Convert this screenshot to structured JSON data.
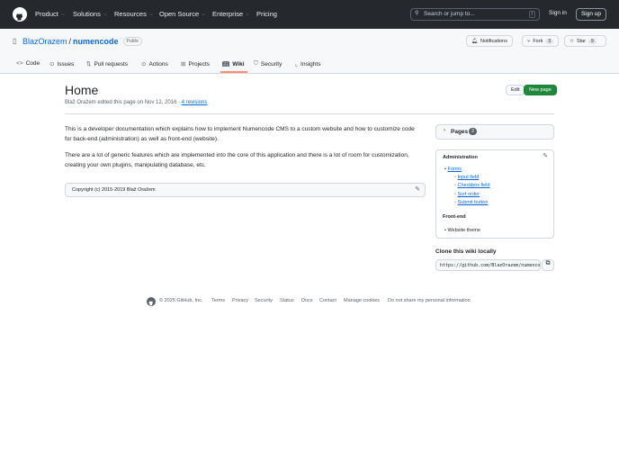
{
  "header": {
    "nav": [
      "Product",
      "Solutions",
      "Resources",
      "Open Source",
      "Enterprise",
      "Pricing"
    ],
    "search_placeholder": "Search or jump to...",
    "slash": "/",
    "sign_in": "Sign in",
    "sign_up": "Sign up"
  },
  "repo": {
    "owner": "BlazOrazem",
    "sep": "/",
    "name": "numencode",
    "visibility": "Public",
    "notifications": "Notifications",
    "fork": "Fork",
    "fork_count": "3",
    "star": "Star",
    "star_count": "9"
  },
  "tabs": [
    "Code",
    "Issues",
    "Pull requests",
    "Actions",
    "Projects",
    "Wiki",
    "Security",
    "Insights"
  ],
  "page": {
    "title": "Home",
    "meta": "Blaž Oražem edited this page on Nov 12, 2016 ·",
    "revisions": "4 revisions",
    "edit": "Edit",
    "new_page": "New page",
    "paragraphs": [
      "This is a developer documentation which explains how to implement Numencode CMS to a custom website and how to customize code for back-end (administration) as well as front-end (website).",
      "There are a lot of generic features which are implemented into the core of this application and there is a lot of room for customization, creating your own plugins, manipulating database, etc."
    ],
    "footer_text": "Copyright (c) 2015-2019 Blaž Oražem"
  },
  "sidebar": {
    "pages_label": "Pages",
    "pages_count": "2",
    "admin_title": "Administration",
    "forms": "Forms",
    "form_items": [
      "Input field",
      "Checkbox field",
      "Sort order",
      "Submit button"
    ],
    "frontend_title": "Front-end",
    "frontend_items": [
      "Website theme"
    ],
    "clone_title": "Clone this wiki locally",
    "clone_url": "https://github.com/BlazOrazem/numencode.wiki.git"
  },
  "footer": {
    "copyright": "© 2025 GitHub, Inc.",
    "links": [
      "Terms",
      "Privacy",
      "Security",
      "Status",
      "Docs",
      "Contact",
      "Manage cookies",
      "Do not share my personal information"
    ]
  },
  "colors": {
    "header_bg": "#25292e",
    "link": "#0969da",
    "primary_button": "#1f883d"
  }
}
